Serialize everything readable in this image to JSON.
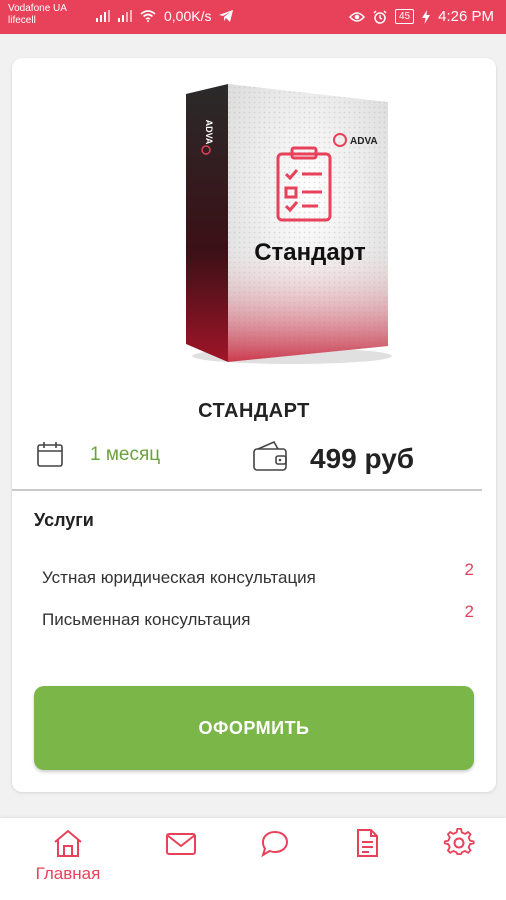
{
  "status_bar": {
    "carrier_line1": "Vodafone UA",
    "carrier_line2": "lifecell",
    "net_speed": "0,00K/s",
    "battery": "45",
    "time": "4:26 PM",
    "icons": [
      "signal-icon",
      "signal-icon",
      "wifi-icon",
      "telegram-icon",
      "eye-icon",
      "alarm-icon",
      "battery-icon",
      "charging-icon"
    ]
  },
  "product": {
    "box_brand": "ADVA",
    "box_side_brand": "ADVA",
    "box_title": "Стандарт",
    "plan_name": "СТАНДАРТ",
    "duration": "1 месяц",
    "price": "499 руб"
  },
  "services": {
    "title": "Услуги",
    "items": [
      {
        "name": "Устная юридическая консультация",
        "count": "2"
      },
      {
        "name": "Письменная консультация",
        "count": "2"
      }
    ]
  },
  "order_button": {
    "label": "ОФОРМИТЬ"
  },
  "bottom_nav": {
    "items": [
      {
        "icon": "home-icon",
        "label": "Главная",
        "active": true
      },
      {
        "icon": "mail-icon",
        "label": ""
      },
      {
        "icon": "chat-icon",
        "label": ""
      },
      {
        "icon": "document-icon",
        "label": ""
      },
      {
        "icon": "settings-icon",
        "label": ""
      }
    ]
  },
  "colors": {
    "accent": "#e8415a",
    "primary_button": "#7ab648",
    "duration_text": "#6aa23e"
  }
}
